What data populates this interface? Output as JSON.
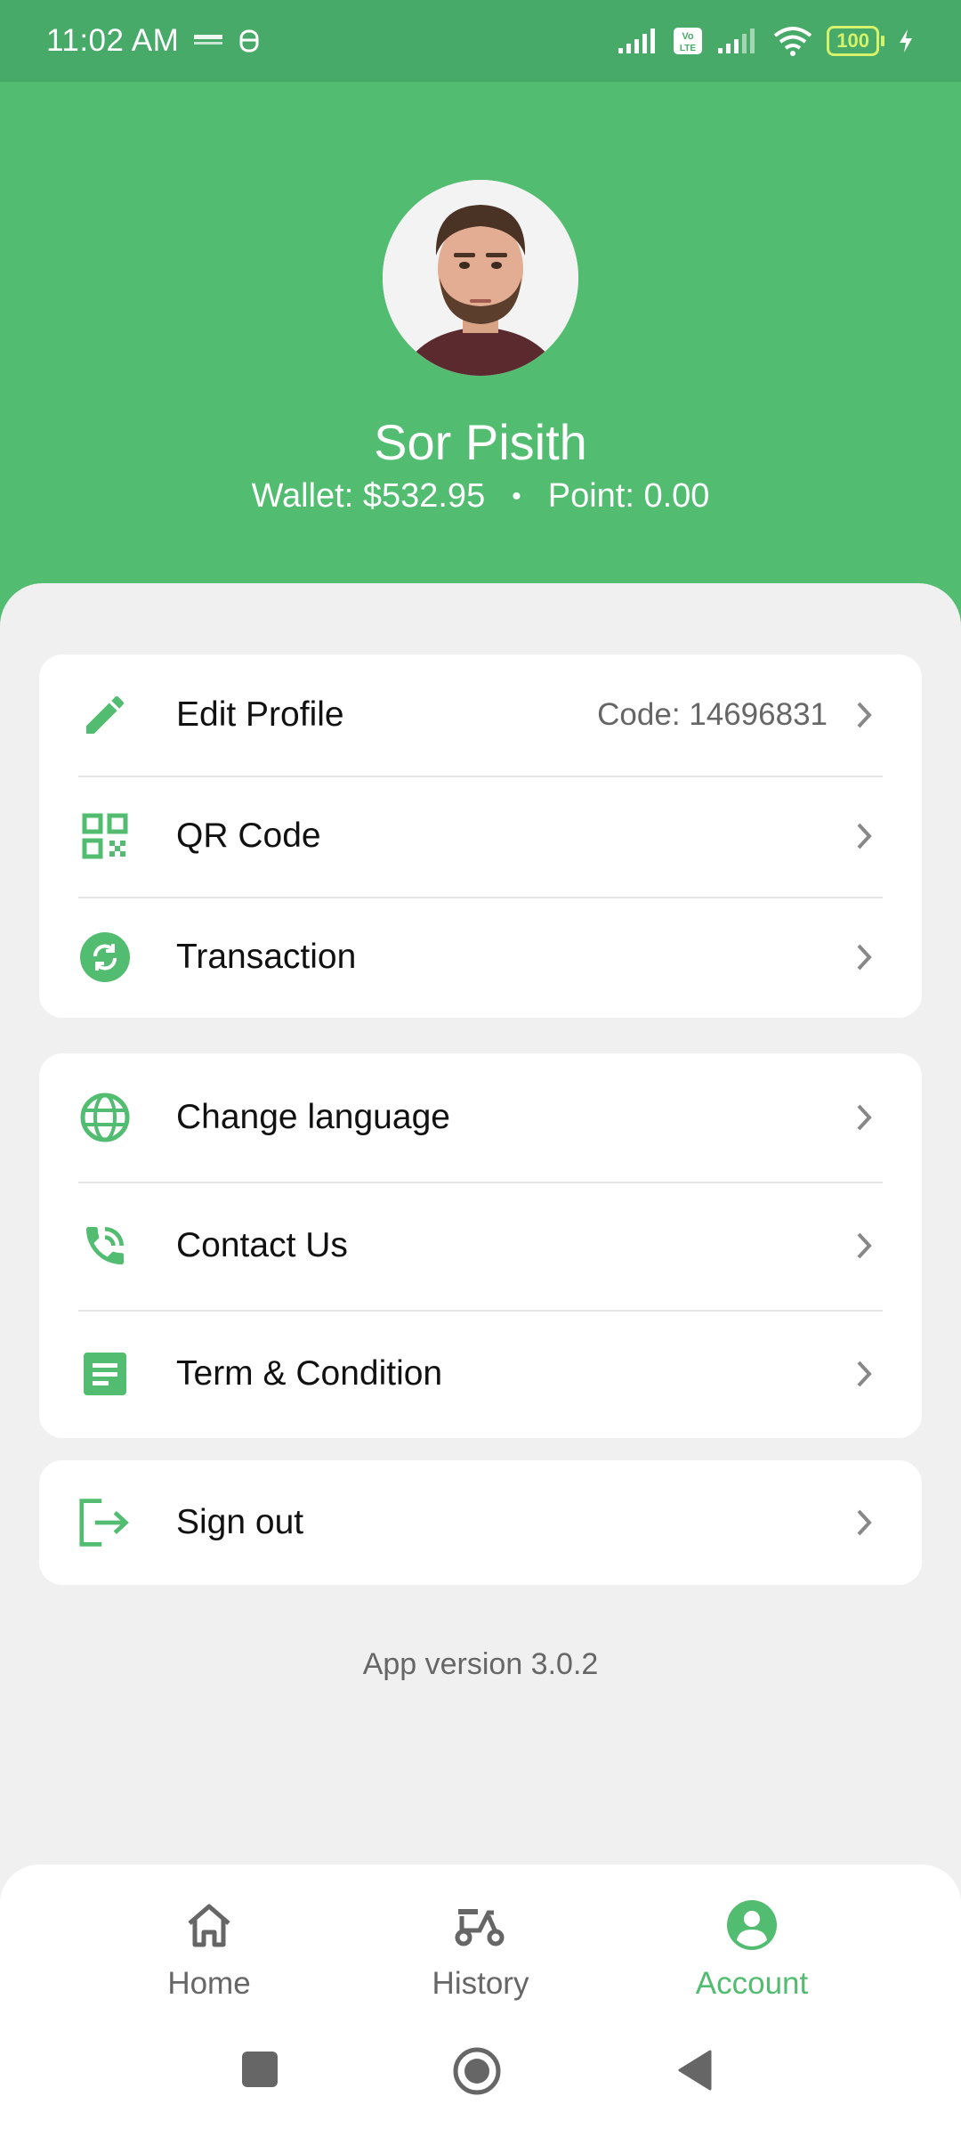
{
  "status_bar": {
    "time": "11:02 AM",
    "battery": "100"
  },
  "profile": {
    "name": "Sor Pisith",
    "wallet": "Wallet: $532.95",
    "separator": "•",
    "point": "Point: 0.00"
  },
  "menu_group_1": {
    "edit_profile": {
      "label": "Edit Profile",
      "value": "Code: 14696831"
    },
    "qr_code": {
      "label": "QR Code"
    },
    "transaction": {
      "label": "Transaction"
    }
  },
  "menu_group_2": {
    "change_language": {
      "label": "Change language"
    },
    "contact_us": {
      "label": "Contact Us"
    },
    "terms": {
      "label": "Term & Condition"
    }
  },
  "menu_group_3": {
    "sign_out": {
      "label": "Sign out"
    }
  },
  "app_version": "App version 3.0.2",
  "bottom_nav": {
    "home": "Home",
    "history": "History",
    "account": "Account",
    "active": "account"
  },
  "colors": {
    "primary": "#52bd70",
    "status_bar": "#48aa68",
    "background": "#f0f0f0"
  }
}
